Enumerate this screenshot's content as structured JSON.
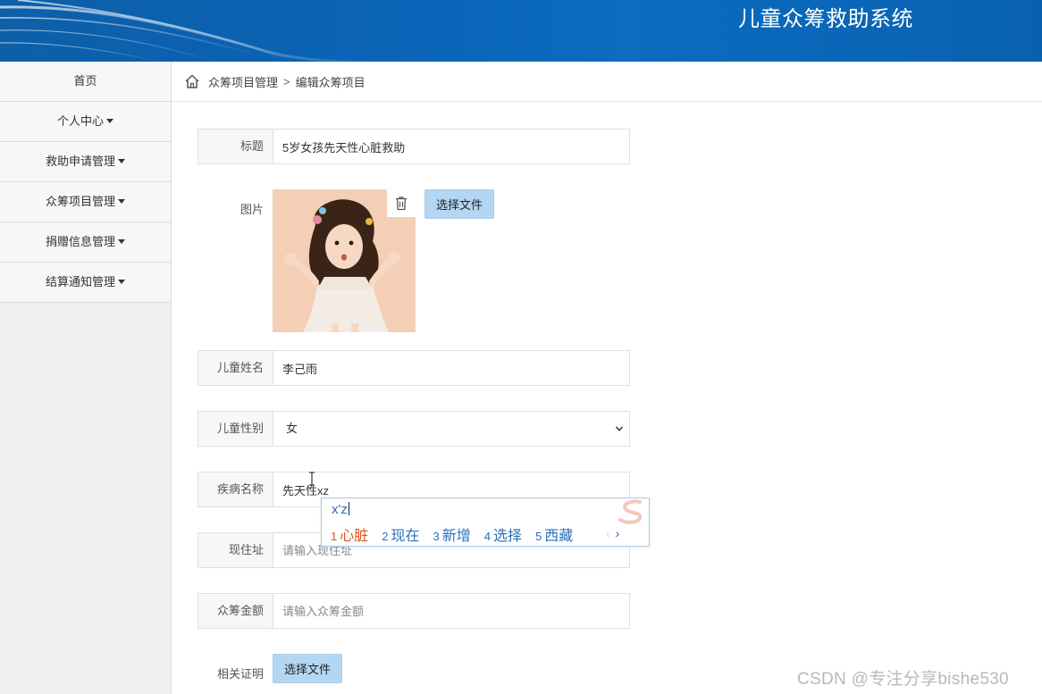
{
  "header": {
    "title": "儿童众筹救助系统"
  },
  "sidebar": {
    "items": [
      {
        "label": "首页",
        "has_caret": false
      },
      {
        "label": "个人中心",
        "has_caret": true
      },
      {
        "label": "救助申请管理",
        "has_caret": true
      },
      {
        "label": "众筹项目管理",
        "has_caret": true
      },
      {
        "label": "捐赠信息管理",
        "has_caret": true
      },
      {
        "label": "结算通知管理",
        "has_caret": true
      }
    ]
  },
  "breadcrumb": {
    "parent": "众筹项目管理",
    "separator": ">",
    "current": "编辑众筹项目"
  },
  "form": {
    "title": {
      "label": "标题",
      "value": "5岁女孩先天性心脏救助"
    },
    "image": {
      "label": "图片",
      "button": "选择文件"
    },
    "child_name": {
      "label": "儿童姓名",
      "value": "李己雨"
    },
    "child_gender": {
      "label": "儿童性别",
      "selected": "女"
    },
    "disease": {
      "label": "疾病名称",
      "value": "先天性xz"
    },
    "address": {
      "label": "现住址",
      "placeholder": "请输入现住址"
    },
    "amount": {
      "label": "众筹金额",
      "placeholder": "请输入众筹金额"
    },
    "proof": {
      "label": "相关证明",
      "button": "选择文件"
    }
  },
  "ime": {
    "composition": "x'z",
    "candidates": [
      {
        "num": "1",
        "text": "心脏"
      },
      {
        "num": "2",
        "text": "现在"
      },
      {
        "num": "3",
        "text": "新增"
      },
      {
        "num": "4",
        "text": "选择"
      },
      {
        "num": "5",
        "text": "西藏"
      }
    ],
    "prev": "‹",
    "next": "›"
  },
  "watermark": "CSDN @专注分享bishe530",
  "colors": {
    "header_blue": "#0a63b5",
    "button_blue": "#b3d6f2",
    "ime_blue": "#2c6fb8",
    "ime_highlight": "#e0531b"
  }
}
